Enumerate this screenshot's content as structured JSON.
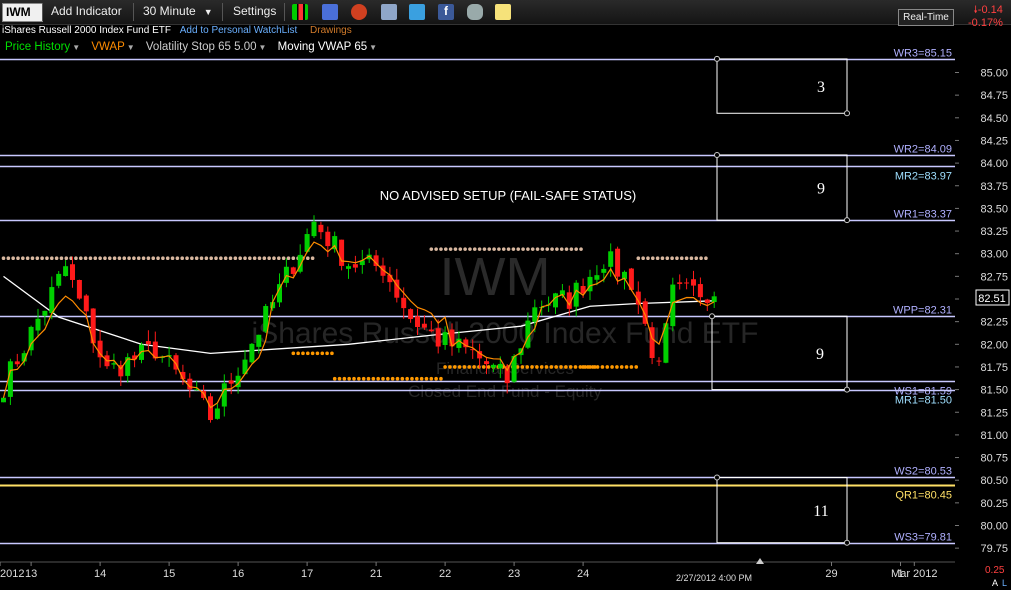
{
  "toolbar": {
    "ticker": "IWM",
    "add_indicator": "Add Indicator",
    "interval": "30 Minute",
    "settings": "Settings",
    "realtime": "Real-Time",
    "change": "-0.14",
    "change_pct": "-0.17%",
    "icons": [
      "bar-chart-icon",
      "save-icon",
      "alarm-icon",
      "layers-icon",
      "twitter-icon",
      "facebook-icon",
      "binoculars-icon",
      "note-icon"
    ]
  },
  "subbar": {
    "security_name": "iShares Russell 2000 Index Fund ETF",
    "watchlist_link": "Add to Personal WatchList",
    "drawings": "Drawings"
  },
  "studies": {
    "price_history": "Price History",
    "vwap": "VWAP",
    "volatility_stop": "Volatility Stop 65 5.00",
    "moving_vwap": "Moving VWAP 65"
  },
  "watermark": {
    "ticker": "IWM",
    "name": "iShares Russell 2000 Index Fund ETF",
    "line3": "Financial Services",
    "line4": "Closed End Fund - Equity"
  },
  "annotation": "NO ADVISED SETUP (FAIL-SAFE STATUS)",
  "status_time": "2/27/2012 4:00 PM",
  "last_price": "82.51",
  "footer": {
    "left_year": "2012",
    "right_tag": "0.25",
    "right_a": "A",
    "right_l": "L"
  },
  "colors": {
    "up": "#00d000",
    "down": "#ff1a1a",
    "vwap": "#ff8c00",
    "stop_high": "#d9b8a0",
    "stop_low": "#ff9900",
    "moving_vwap": "#ffffff",
    "level_line": "#c8c8ff",
    "level_text": "#b0b0ff",
    "mr_text": "#9fdfff",
    "qr": "#ffe066"
  },
  "chart_data": {
    "type": "candlestick",
    "y_axis": {
      "min": 79.75,
      "max": 85.0,
      "step": 0.25,
      "side": "right"
    },
    "x_ticks": [
      {
        "label": "2012",
        "slot": -0.5
      },
      {
        "label": "13",
        "slot": 4
      },
      {
        "label": "14",
        "slot": 14
      },
      {
        "label": "15",
        "slot": 24
      },
      {
        "label": "16",
        "slot": 34
      },
      {
        "label": "17",
        "slot": 44
      },
      {
        "label": "21",
        "slot": 54
      },
      {
        "label": "22",
        "slot": 64
      },
      {
        "label": "23",
        "slot": 74
      },
      {
        "label": "24",
        "slot": 84
      },
      {
        "label": "29",
        "slot": 120
      },
      {
        "label": "1",
        "slot": 130
      },
      {
        "label": "Mar 2012",
        "slot": 132
      }
    ],
    "levels": [
      {
        "name": "WR3",
        "label": "WR3=85.15",
        "value": 85.15,
        "kind": "w"
      },
      {
        "name": "WR2",
        "label": "WR2=84.09",
        "value": 84.09,
        "kind": "w"
      },
      {
        "name": "MR2",
        "label": "MR2=83.97",
        "value": 83.97,
        "kind": "m"
      },
      {
        "name": "WR1",
        "label": "WR1=83.37",
        "value": 83.37,
        "kind": "w"
      },
      {
        "name": "WPP",
        "label": "WPP=82.31",
        "value": 82.31,
        "kind": "w"
      },
      {
        "name": "WS1",
        "label": "WS1=81.59",
        "value": 81.59,
        "kind": "w"
      },
      {
        "name": "MR1",
        "label": "MR1=81.50",
        "value": 81.5,
        "kind": "m"
      },
      {
        "name": "WS2",
        "label": "WS2=80.53",
        "value": 80.53,
        "kind": "w"
      },
      {
        "name": "QR1",
        "label": "QR1=80.45",
        "value": 80.45,
        "kind": "q"
      },
      {
        "name": "WS3",
        "label": "WS3=79.81",
        "value": 79.81,
        "kind": "w"
      }
    ],
    "zones": [
      {
        "label": "3",
        "top": 85.15,
        "bottom": 84.55
      },
      {
        "label": "9",
        "top": 84.09,
        "bottom": 83.37
      },
      {
        "label": "9",
        "top": 82.31,
        "bottom": 81.5
      },
      {
        "label": "11",
        "top": 80.53,
        "bottom": 79.81
      }
    ],
    "anchor_points": [
      {
        "slot": 9,
        "price": 82.85
      },
      {
        "slot": 15,
        "price": 81.7
      },
      {
        "slot": 22,
        "price": 81.95
      },
      {
        "slot": 30,
        "price": 81.2
      },
      {
        "slot": 38,
        "price": 82.3
      },
      {
        "slot": 45,
        "price": 83.35
      },
      {
        "slot": 50,
        "price": 82.9
      },
      {
        "slot": 55,
        "price": 82.85
      },
      {
        "slot": 59,
        "price": 82.3
      },
      {
        "slot": 63,
        "price": 82.05
      },
      {
        "slot": 68,
        "price": 81.9
      },
      {
        "slot": 73,
        "price": 81.6
      },
      {
        "slot": 77,
        "price": 82.45
      },
      {
        "slot": 82,
        "price": 82.5
      },
      {
        "slot": 87,
        "price": 82.95
      },
      {
        "slot": 91,
        "price": 82.7
      },
      {
        "slot": 95,
        "price": 81.7
      },
      {
        "slot": 97,
        "price": 82.55
      },
      {
        "slot": 103,
        "price": 82.6
      }
    ],
    "volatility_stop": [
      {
        "from": 0,
        "to": 45,
        "value": 82.95,
        "color": "stop_high"
      },
      {
        "from": 42,
        "to": 48,
        "value": 81.9,
        "color": "stop_low"
      },
      {
        "from": 48,
        "to": 64,
        "value": 81.62,
        "color": "stop_low"
      },
      {
        "from": 64,
        "to": 86,
        "value": 81.75,
        "color": "stop_low"
      },
      {
        "from": 62,
        "to": 84,
        "value": 83.05,
        "color": "stop_high"
      },
      {
        "from": 84,
        "to": 92,
        "value": 81.75,
        "color": "stop_low"
      },
      {
        "from": 92,
        "to": 102,
        "value": 82.95,
        "color": "stop_high"
      }
    ],
    "moving_vwap": [
      {
        "slot": 0,
        "price": 82.75
      },
      {
        "slot": 8,
        "price": 82.3
      },
      {
        "slot": 20,
        "price": 82.0
      },
      {
        "slot": 30,
        "price": 81.9
      },
      {
        "slot": 40,
        "price": 81.95
      },
      {
        "slot": 50,
        "price": 82.0
      },
      {
        "slot": 62,
        "price": 82.1
      },
      {
        "slot": 75,
        "price": 82.2
      },
      {
        "slot": 85,
        "price": 82.42
      },
      {
        "slot": 92,
        "price": 82.45
      },
      {
        "slot": 103,
        "price": 82.48
      }
    ]
  }
}
